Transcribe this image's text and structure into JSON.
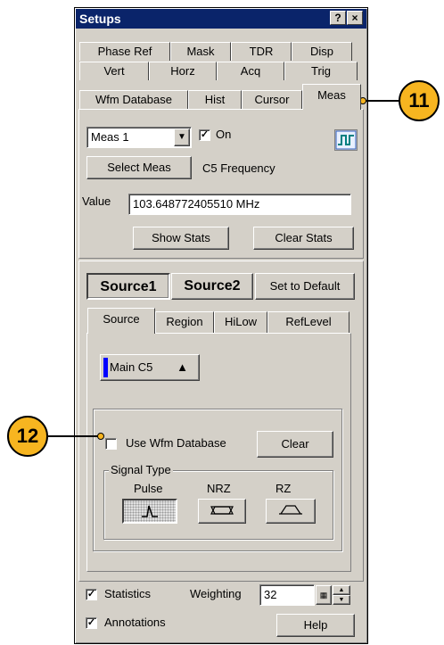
{
  "window": {
    "title": "Setups",
    "help_glyph": "?",
    "close_glyph": "×"
  },
  "tabs": {
    "row1": [
      "Phase Ref",
      "Mask",
      "TDR",
      "Disp"
    ],
    "row2": [
      "Vert",
      "Horz",
      "Acq",
      "Trig"
    ],
    "row3": [
      "Wfm Database",
      "Hist",
      "Cursor",
      "Meas"
    ]
  },
  "meas": {
    "select_value": "Meas 1",
    "on_label": "On",
    "on_checked": "✓",
    "select_meas_label": "Select Meas",
    "meas_name": "C5 Frequency",
    "value_label": "Value",
    "value": "103.648772405510 MHz",
    "show_stats_label": "Show Stats",
    "clear_stats_label": "Clear Stats"
  },
  "source": {
    "source1_label": "Source1",
    "source2_label": "Source2",
    "set_default_label": "Set to Default",
    "subtabs": [
      "Source",
      "Region",
      "HiLow",
      "RefLevel"
    ],
    "source_value": "Main C5",
    "source_arrow": "▲",
    "use_wfm_db_label": "Use Wfm Database",
    "clear_label": "Clear",
    "signal_type_label": "Signal Type",
    "signal_types": [
      "Pulse",
      "NRZ",
      "RZ"
    ]
  },
  "footer": {
    "statistics_label": "Statistics",
    "statistics_checked": "✓",
    "weighting_label": "Weighting",
    "weighting_value": "32",
    "annotations_label": "Annotations",
    "annotations_checked": "✓",
    "help_label": "Help"
  },
  "callouts": [
    "11",
    "12"
  ],
  "colors": {
    "titlebar": "#0a246a",
    "panel": "#d4d0c8",
    "callout": "#f7b520",
    "source_marker": "#0000ff"
  }
}
